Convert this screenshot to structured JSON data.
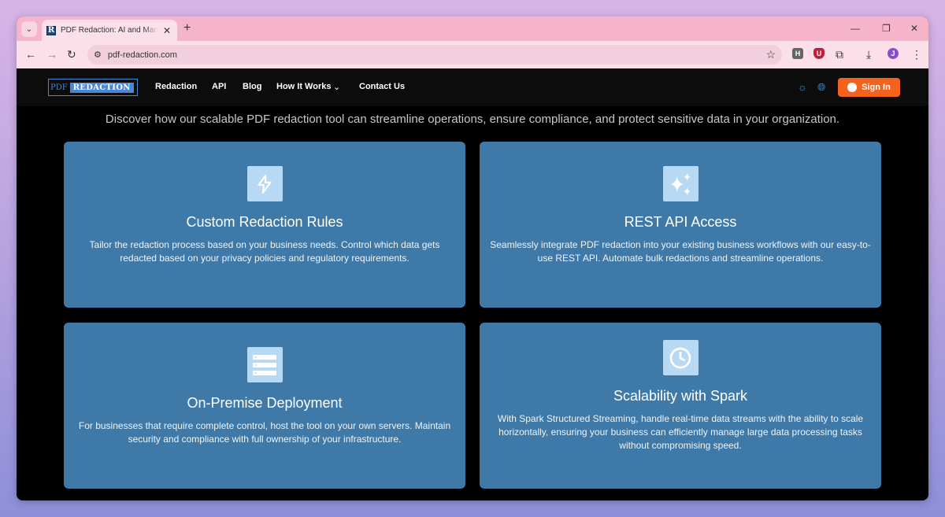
{
  "browser": {
    "tab_title": "PDF Redaction: AI and Manual Redaction",
    "favicon_letter": "R",
    "url": "pdf-redaction.com",
    "profile_initial": "J"
  },
  "header": {
    "logo_pdf": "PDF",
    "logo_redaction": "REDACTION",
    "nav": [
      "Redaction",
      "API",
      "Blog",
      "How It Works",
      "Contact Us"
    ],
    "signin_label": "Sign In"
  },
  "main": {
    "subtitle": "Discover how our scalable PDF redaction tool can streamline operations, ensure compliance, and protect sensitive data in your organization.",
    "cards": [
      {
        "icon": "lightning-icon",
        "title": "Custom Redaction Rules",
        "desc": "Tailor the redaction process based on your business needs. Control which data gets redacted based on your privacy policies and regulatory requirements."
      },
      {
        "icon": "sparkles-icon",
        "title": "REST API Access",
        "desc": "Seamlessly integrate PDF redaction into your existing business workflows with our easy-to-use REST API. Automate bulk redactions and streamline operations."
      },
      {
        "icon": "server-icon",
        "title": "On-Premise Deployment",
        "desc": "For businesses that require complete control, host the tool on your own servers. Maintain security and compliance with full ownership of your infrastructure."
      },
      {
        "icon": "clock-icon",
        "title": "Scalability with Spark",
        "desc": "With Spark Structured Streaming, handle real-time data streams with the ability to scale horizontally, ensuring your business can efficiently manage large data processing tasks without compromising speed."
      }
    ]
  },
  "colors": {
    "card_bg": "#3e79a8",
    "icon_bg": "#b8d9f4",
    "accent": "#f4631e",
    "logo_blue": "#4a87d6"
  }
}
